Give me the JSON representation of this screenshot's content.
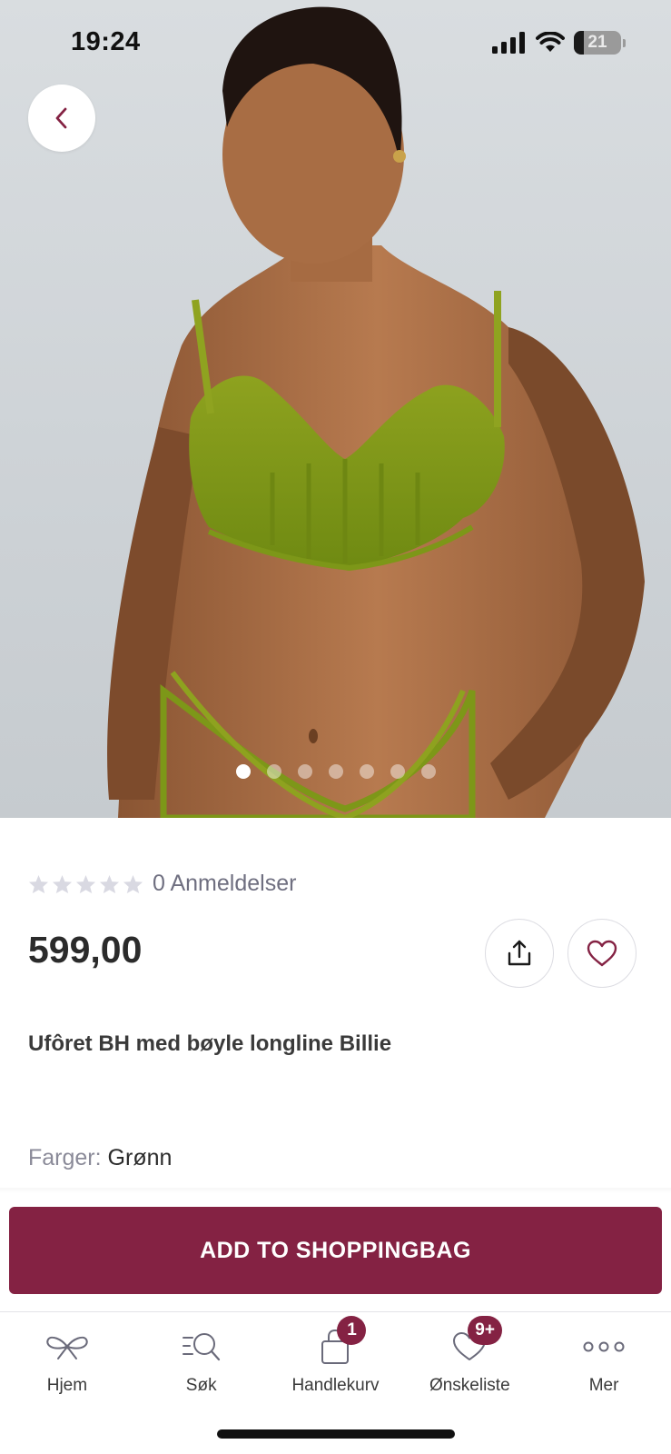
{
  "status_bar": {
    "time": "19:24",
    "battery": "21",
    "battery_level_percent": 21,
    "icons": [
      "cellular-signal-icon",
      "wifi-icon",
      "battery-icon"
    ]
  },
  "hero": {
    "image_description": "Model wearing green unlined longline underwire bra and briefs",
    "carousel": {
      "total": 7,
      "active_index": 0
    }
  },
  "navigation": {
    "back_icon": "chevron-left-icon"
  },
  "product": {
    "rating_stars": 0,
    "rating_max": 5,
    "reviews_label": "0 Anmeldelser",
    "price": "599,00",
    "title": "Ufôret BH med bøyle longline Billie",
    "colors_label": "Farger:",
    "colors_value": "Grønn"
  },
  "actions": {
    "share_icon": "share-icon",
    "wishlist_icon": "heart-icon",
    "add_to_bag_label": "ADD TO SHOPPINGBAG"
  },
  "tab_bar": {
    "items": [
      {
        "label": "Hjem",
        "icon": "bow-icon"
      },
      {
        "label": "Søk",
        "icon": "search-icon"
      },
      {
        "label": "Handlekurv",
        "icon": "shopping-bag-icon",
        "badge": "1"
      },
      {
        "label": "Ønskeliste",
        "icon": "heart-icon",
        "badge": "9+"
      },
      {
        "label": "Mer",
        "icon": "more-dots-icon"
      }
    ]
  },
  "colors": {
    "brand": "#842243",
    "text": "#2b2b2b",
    "muted": "#8a8a98",
    "star_empty": "#d9d9e2"
  }
}
